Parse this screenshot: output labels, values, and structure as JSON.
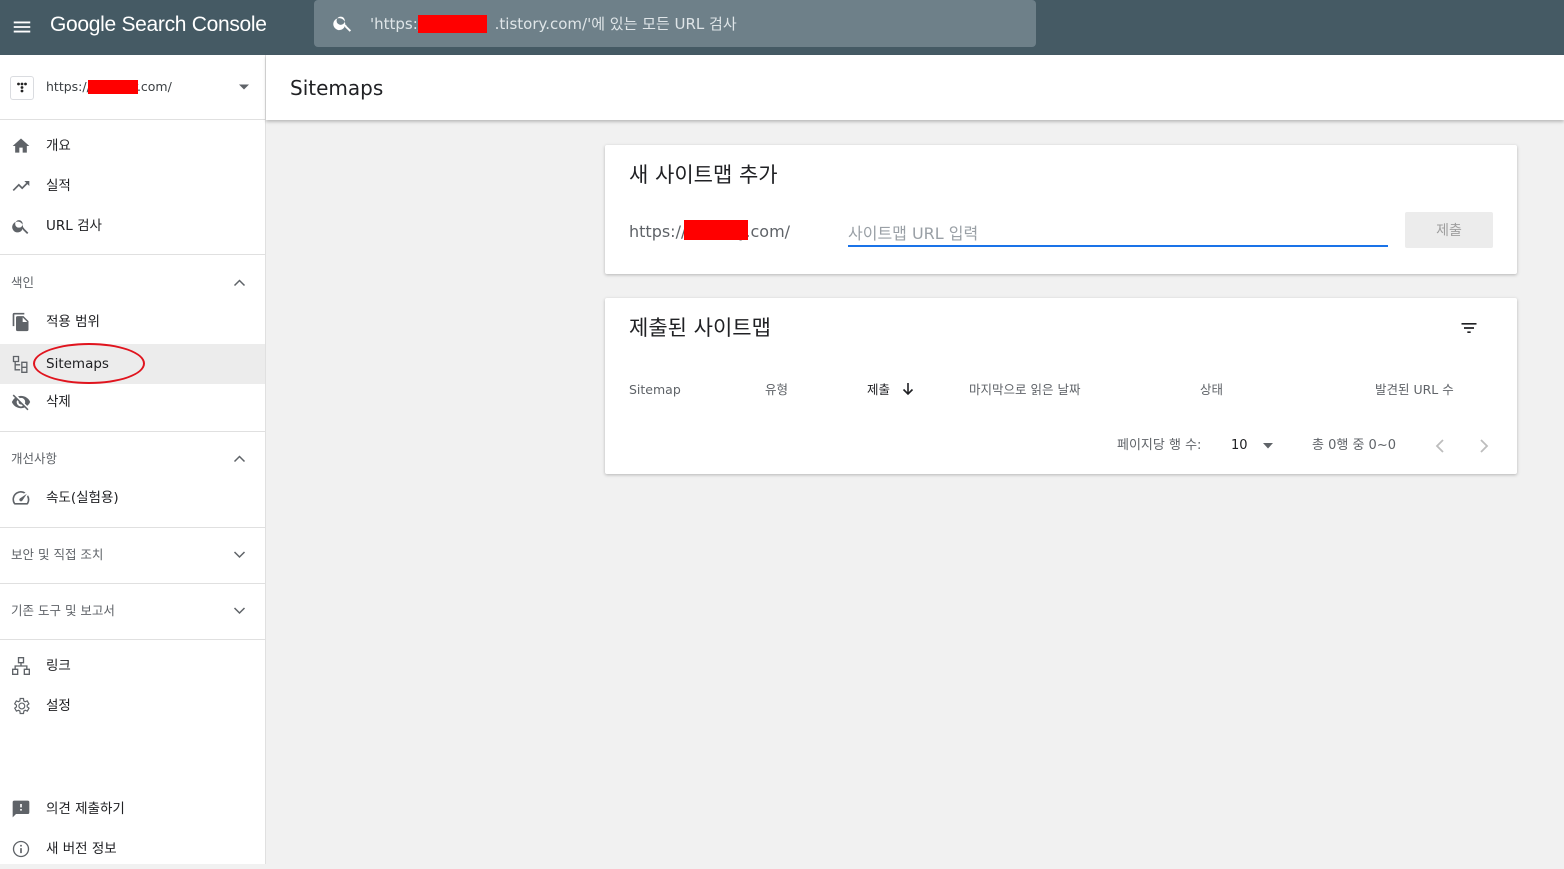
{
  "topbar": {
    "product_name": "Google Search Console",
    "search_placeholder": "'https://              .tistory.com/'에 있는 모든 URL 검사"
  },
  "sidebar": {
    "property_url": "https://              .tistory.com/",
    "items_top": [
      {
        "label": "개요",
        "icon": "home-icon"
      },
      {
        "label": "실적",
        "icon": "trending-up-icon"
      },
      {
        "label": "URL 검사",
        "icon": "search-icon"
      }
    ],
    "sections": {
      "index": {
        "label": "색인",
        "items": [
          {
            "label": "적용 범위",
            "icon": "file-copy-icon"
          },
          {
            "label": "Sitemaps",
            "icon": "sitemap-icon",
            "active": true
          },
          {
            "label": "삭제",
            "icon": "visibility-off-icon"
          }
        ]
      },
      "enhancements": {
        "label": "개선사항",
        "items": [
          {
            "label": "속도(실험용)",
            "icon": "speed-icon"
          }
        ]
      },
      "security": {
        "label": "보안 및 직접 조치"
      },
      "legacy": {
        "label": "기존 도구 및 보고서"
      }
    },
    "items_bottom": [
      {
        "label": "링크",
        "icon": "links-icon"
      },
      {
        "label": "설정",
        "icon": "settings-icon"
      }
    ],
    "footer": [
      {
        "label": "의견 제출하기",
        "icon": "feedback-icon"
      },
      {
        "label": "새 버전 정보",
        "icon": "info-icon"
      }
    ]
  },
  "page": {
    "title": "Sitemaps"
  },
  "add_card": {
    "title": "새 사이트맵 추가",
    "url_prefix": "https://              .tistory.com/",
    "input_placeholder": "사이트맵 URL 입력",
    "submit_label": "제출"
  },
  "submitted_card": {
    "title": "제출된 사이트맵",
    "columns": [
      "Sitemap",
      "유형",
      "제출",
      "마지막으로 읽은 날짜",
      "상태",
      "발견된 URL 수"
    ],
    "sorted_column": "제출",
    "pagination": {
      "rows_per_page_label": "페이지당 행 수:",
      "rows_per_page": "10",
      "range_text": "총 0행 중 0~0"
    }
  },
  "colors": {
    "topbar": "#455a64",
    "search_box": "#6e8089",
    "accent": "#1a73e8",
    "annotation": "#e0141e",
    "redaction": "#ff0000"
  }
}
